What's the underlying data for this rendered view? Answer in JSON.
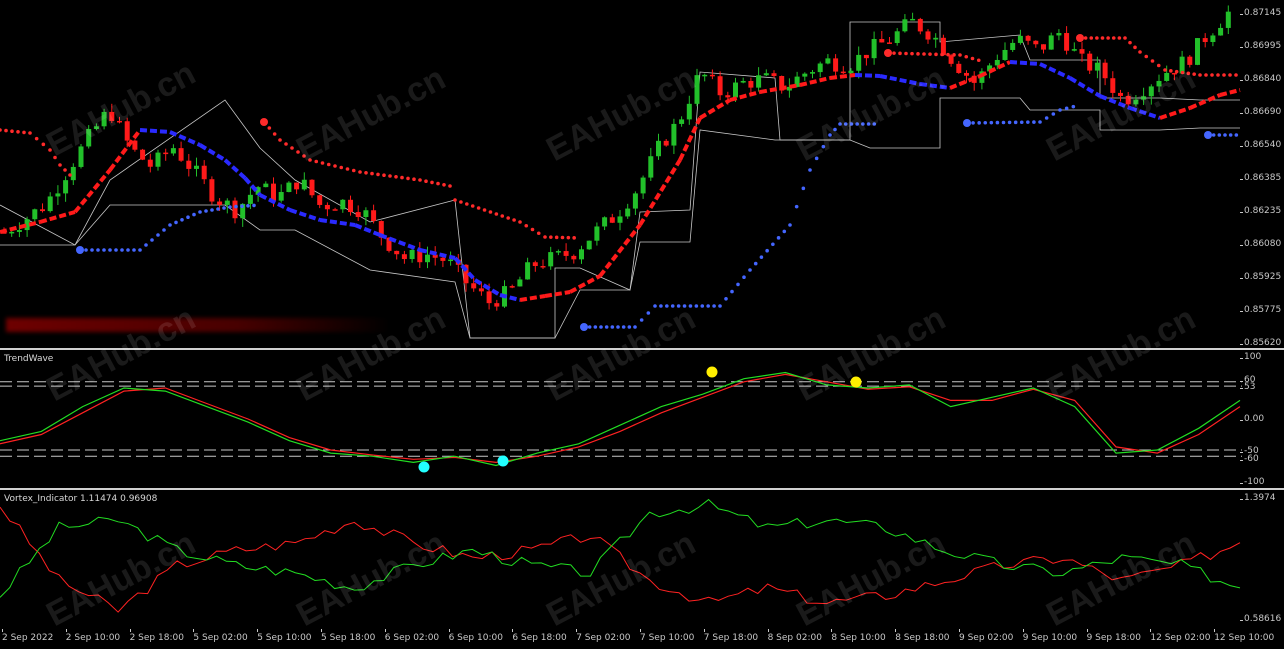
{
  "colors": {
    "background": "#000000",
    "bull_candle": "#22c02a",
    "bear_candle": "#ff1a1a",
    "trend_line_blue": "#2a2aff",
    "trend_line_red": "#ff1a1a",
    "dots_red": "#ff2a2a",
    "dots_blue": "#4466ff",
    "wave_green": "#22dd22",
    "wave_red": "#ff2222",
    "channel": "#c8c8c8",
    "cyan_marker": "#22ffff",
    "yellow_marker": "#ffee00"
  },
  "price_axis": {
    "ticks": [
      "0.87145",
      "0.86995",
      "0.86840",
      "0.86690",
      "0.86540",
      "0.86385",
      "0.86235",
      "0.86080",
      "0.85925",
      "0.85775",
      "0.85620"
    ]
  },
  "trendwave": {
    "label": "TrendWave",
    "ticks": [
      "100",
      "60",
      "53",
      "0.00",
      "-50",
      "-60",
      "-100"
    ]
  },
  "vortex": {
    "label": "Vortex_Indicator 1.11474 0.96908",
    "ticks": [
      "1.3974",
      "0.58616"
    ]
  },
  "time_axis": {
    "ticks": [
      "2 Sep 2022",
      "2 Sep 10:00",
      "2 Sep 18:00",
      "5 Sep 02:00",
      "5 Sep 10:00",
      "5 Sep 18:00",
      "6 Sep 02:00",
      "6 Sep 10:00",
      "6 Sep 18:00",
      "7 Sep 02:00",
      "7 Sep 10:00",
      "7 Sep 18:00",
      "8 Sep 02:00",
      "8 Sep 10:00",
      "8 Sep 18:00",
      "9 Sep 02:00",
      "9 Sep 10:00",
      "9 Sep 18:00",
      "12 Sep 02:00",
      "12 Sep 10:00"
    ]
  },
  "watermark": "EAHub.cn",
  "chart_data": [
    {
      "type": "candlestick",
      "title": "",
      "ylim": [
        0.8562,
        0.8716
      ],
      "series": [
        {
          "name": "close",
          "values": [
            0.8612,
            0.8618,
            0.8625,
            0.864,
            0.8655,
            0.8668,
            0.865,
            0.8642,
            0.8651,
            0.864,
            0.8628,
            0.8622,
            0.8633,
            0.8628,
            0.8636,
            0.8624,
            0.8626,
            0.8622,
            0.8609,
            0.86,
            0.8602,
            0.8599,
            0.8588,
            0.858,
            0.8585,
            0.8597,
            0.86,
            0.8603,
            0.8612,
            0.862,
            0.8632,
            0.865,
            0.8663,
            0.8685,
            0.8675,
            0.868,
            0.8682,
            0.8678,
            0.8685,
            0.869,
            0.8688,
            0.8695,
            0.87,
            0.8708,
            0.8702,
            0.869,
            0.868,
            0.8692,
            0.87,
            0.8695,
            0.8703,
            0.869,
            0.8685,
            0.8672,
            0.8678,
            0.8685,
            0.869,
            0.8702,
            0.8712
          ]
        }
      ]
    },
    {
      "type": "line",
      "title": "",
      "ylim": [
        -100,
        100
      ],
      "series": [
        {
          "name": "",
          "values": [
            -35,
            -20,
            20,
            50,
            45,
            20,
            -5,
            -35,
            -55,
            -60,
            -70,
            -60,
            -75,
            -55,
            -40,
            -10,
            20,
            40,
            65,
            75,
            55,
            50,
            55,
            20,
            35,
            50,
            20,
            -55,
            -50,
            -15,
            30
          ]
        },
        {
          "name": "",
          "values": [
            -40,
            -25,
            10,
            45,
            50,
            25,
            0,
            -30,
            -50,
            -58,
            -65,
            -62,
            -70,
            -60,
            -45,
            -20,
            10,
            35,
            60,
            72,
            60,
            48,
            52,
            30,
            30,
            48,
            30,
            -45,
            -55,
            -25,
            20
          ]
        }
      ]
    },
    {
      "type": "line",
      "title": "",
      "ylim": [
        0.58616,
        1.3974
      ],
      "series": [
        {
          "name": "",
          "values": [
            1.35,
            0.85,
            0.65,
            0.95,
            1.05,
            1.1,
            1.25,
            1.1,
            1.0,
            1.05,
            1.15,
            0.85,
            0.7,
            0.8,
            0.7,
            0.75,
            0.85,
            0.95,
            1.0,
            0.85,
            0.95,
            1.1
          ]
        },
        {
          "name": "",
          "values": [
            0.75,
            1.2,
            1.25,
            1.05,
            0.95,
            0.9,
            0.8,
            0.95,
            1.05,
            0.95,
            0.9,
            1.3,
            1.35,
            1.2,
            1.25,
            1.2,
            1.05,
            0.95,
            0.9,
            1.0,
            0.95,
            0.8
          ]
        }
      ]
    }
  ]
}
